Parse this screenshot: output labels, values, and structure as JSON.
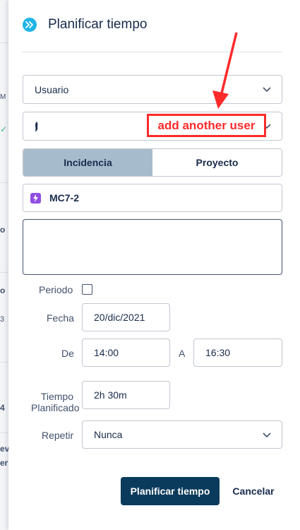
{
  "dialog": {
    "title": "Planificar tiempo",
    "user_select": {
      "value": "Usuario"
    },
    "user_field": {
      "annotation": "add another user"
    },
    "tabs": [
      {
        "label": "Incidencia",
        "active": true
      },
      {
        "label": "Proyecto",
        "active": false
      }
    ],
    "issue": {
      "key": "MC7-2",
      "icon": "lightning-icon"
    },
    "description": {
      "value": ""
    },
    "periodo": {
      "label": "Periodo",
      "checked": false
    },
    "fecha": {
      "label": "Fecha",
      "value": "20/dic/2021"
    },
    "de": {
      "label": "De",
      "value": "14:00"
    },
    "a": {
      "label": "A",
      "value": "16:30"
    },
    "tiempo": {
      "label_line1": "Tiempo",
      "label_line2": "Planificado",
      "value": "2h 30m"
    },
    "repetir": {
      "label": "Repetir",
      "value": "Nunca"
    },
    "buttons": {
      "primary": "Planificar tiempo",
      "cancel": "Cancelar"
    }
  },
  "background": {
    "fragments": [
      "M",
      "o",
      "o",
      "3",
      "4",
      "ev",
      "er"
    ]
  },
  "colors": {
    "accent_header_icon": "#1fb5e6",
    "primary_button": "#0b3b5c",
    "active_tab": "#a6bccc",
    "issue_icon": "#904ee2",
    "annotation": "#ff2a2a"
  }
}
